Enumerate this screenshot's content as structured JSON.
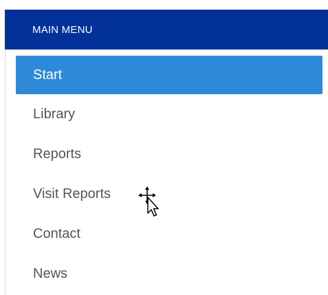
{
  "menu": {
    "header": "MAIN MENU",
    "items": [
      {
        "label": "Start",
        "active": true
      },
      {
        "label": "Library",
        "active": false
      },
      {
        "label": "Reports",
        "active": false
      },
      {
        "label": "Visit Reports",
        "active": false
      },
      {
        "label": "Contact",
        "active": false
      },
      {
        "label": "News",
        "active": false
      }
    ]
  },
  "colors": {
    "header_bg": "#03319a",
    "active_bg": "#2e8ad8",
    "item_text": "#555555"
  },
  "cursor": {
    "icon": "move-pointer-cursor-icon"
  }
}
